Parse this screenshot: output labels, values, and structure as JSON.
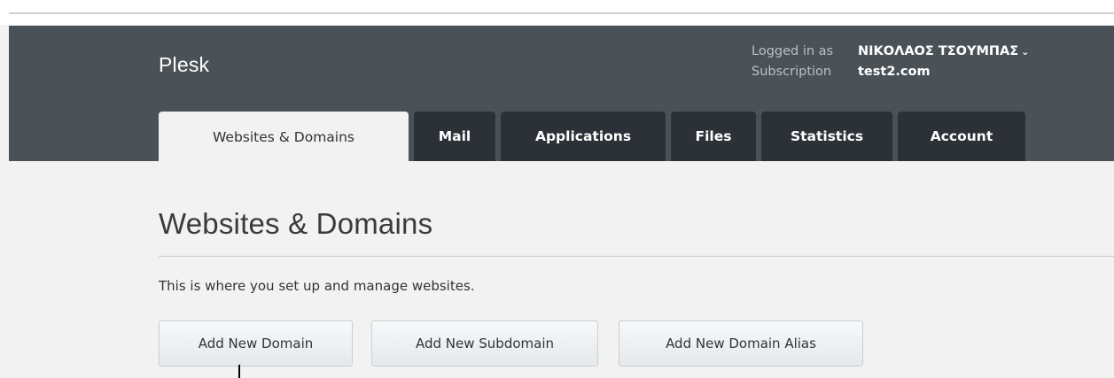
{
  "header": {
    "logo": "Plesk",
    "logged_in_label": "Logged in as",
    "user_name": "ΝΙΚΟΛΑΟΣ ΤΣΟΥΜΠΑΣ",
    "user_caret": "⌄",
    "subscription_label": "Subscription",
    "subscription_value": "test2.com",
    "colors": {
      "bar": "#4a5258",
      "tab": "#2b3136",
      "active_tab": "#f2f2f2"
    }
  },
  "tabs": [
    {
      "label": "Websites & Domains",
      "active": true
    },
    {
      "label": "Mail",
      "active": false
    },
    {
      "label": "Applications",
      "active": false
    },
    {
      "label": "Files",
      "active": false
    },
    {
      "label": "Statistics",
      "active": false
    },
    {
      "label": "Account",
      "active": false
    }
  ],
  "main": {
    "title": "Websites & Domains",
    "description": "This is where you set up and manage websites.",
    "buttons": [
      {
        "label": "Add New Domain"
      },
      {
        "label": "Add New Subdomain"
      },
      {
        "label": "Add New Domain Alias"
      }
    ]
  }
}
